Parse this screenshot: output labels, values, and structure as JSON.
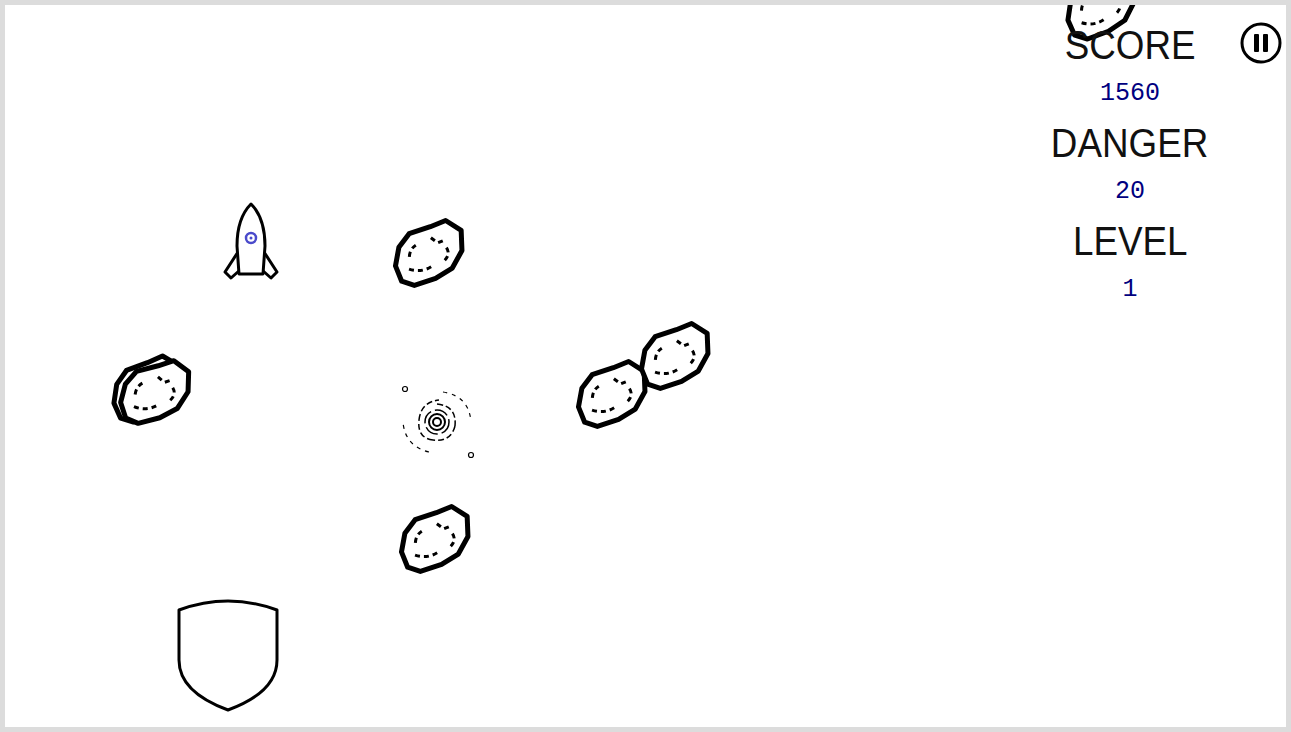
{
  "hud": [
    {
      "label": "SCORE",
      "value": "1560"
    },
    {
      "label": "DANGER",
      "value": "20"
    },
    {
      "label": "LEVEL",
      "value": "1"
    }
  ],
  "sprites": [
    {
      "kind": "rocket"
    },
    {
      "kind": "asteroid"
    },
    {
      "kind": "asteroid"
    },
    {
      "kind": "asteroid"
    },
    {
      "kind": "asteroid"
    },
    {
      "kind": "asteroid"
    },
    {
      "kind": "asteroid"
    },
    {
      "kind": "asteroid"
    },
    {
      "kind": "blackhole"
    },
    {
      "kind": "shield"
    }
  ]
}
